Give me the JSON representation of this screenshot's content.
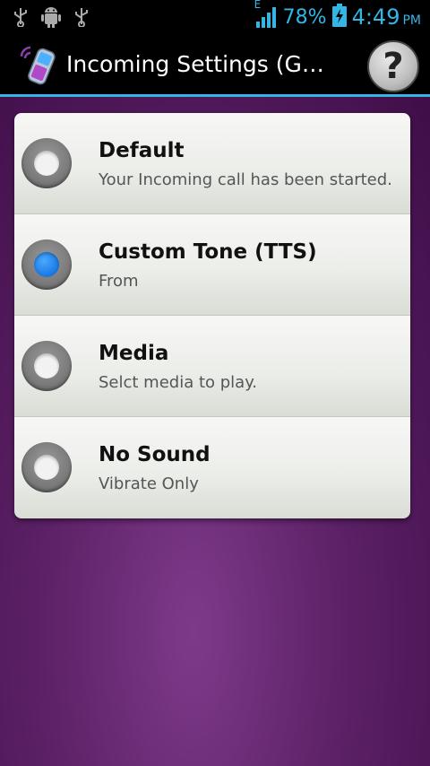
{
  "status_bar": {
    "left_icons": [
      "usb-icon",
      "android-debug-icon",
      "usb-icon"
    ],
    "network_label": "E",
    "battery_percent": "78%",
    "time": "4:49",
    "ampm": "PM"
  },
  "title_bar": {
    "title": "Incoming Settings (Ge…",
    "help_label": "?"
  },
  "options": [
    {
      "title": "Default",
      "subtitle": "Your Incoming call has been started.",
      "selected": false
    },
    {
      "title": "Custom Tone (TTS)",
      "subtitle": "From",
      "selected": true
    },
    {
      "title": "Media",
      "subtitle": "Selct media to play.",
      "selected": false
    },
    {
      "title": "No Sound",
      "subtitle": "Vibrate Only",
      "selected": false
    }
  ],
  "colors": {
    "accent": "#33b5e5",
    "background_purple": "#5c2166",
    "radio_selected": "#1f7fe6"
  }
}
